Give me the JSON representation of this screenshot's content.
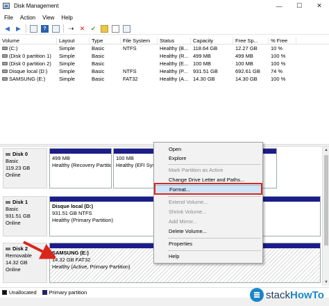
{
  "window": {
    "title": "Disk Management",
    "min": "—",
    "max": "☐",
    "close": "✕"
  },
  "menu": [
    "File",
    "Action",
    "View",
    "Help"
  ],
  "toolbar": {
    "icons": [
      "back-arrow-icon",
      "forward-arrow-icon",
      "disk-list-icon",
      "help-icon",
      "disk-grid-icon",
      "connect-icon",
      "delete-icon",
      "check-icon",
      "folder-icon",
      "document-icon",
      "properties-icon"
    ]
  },
  "columns": [
    "Volume",
    "Layout",
    "Type",
    "File System",
    "Status",
    "Capacity",
    "Free Sp...",
    "% Free"
  ],
  "volumes": [
    [
      "(C:)",
      "Simple",
      "Basic",
      "NTFS",
      "Healthy (B...",
      "118.64 GB",
      "12.27 GB",
      "10 %"
    ],
    [
      "(Disk 0 partition 1)",
      "Simple",
      "Basic",
      "",
      "Healthy (R...",
      "499 MB",
      "499 MB",
      "100 %"
    ],
    [
      "(Disk 0 partition 2)",
      "Simple",
      "Basic",
      "",
      "Healthy (E...",
      "100 MB",
      "100 MB",
      "100 %"
    ],
    [
      "Disque local (D:)",
      "Simple",
      "Basic",
      "NTFS",
      "Healthy (P...",
      "931.51 GB",
      "692.61 GB",
      "74 %"
    ],
    [
      "SAMSUNG (E:)",
      "Simple",
      "Basic",
      "FAT32",
      "Healthy (A...",
      "14.30 GB",
      "14.30 GB",
      "100 %"
    ]
  ],
  "disks": [
    {
      "name": "Disk 0",
      "type": "Basic",
      "size": "119.23 GB",
      "state": "Online",
      "partitions": [
        {
          "name": "",
          "size": "499 MB",
          "status": "Healthy (Recovery Partition)"
        },
        {
          "name": "",
          "size": "100 MB",
          "status": "Healthy (EFI System Partition)"
        },
        {
          "name": "",
          "size": "",
          "status": ""
        }
      ]
    },
    {
      "name": "Disk 1",
      "type": "Basic",
      "size": "931.51 GB",
      "state": "Online",
      "partitions": [
        {
          "name": "Disque local  (D:)",
          "size": "931.51 GB NTFS",
          "status": "Healthy (Primary Partition)"
        }
      ]
    },
    {
      "name": "Disk 2",
      "type": "Removable",
      "size": "14.32 GB",
      "state": "Online",
      "partitions": [
        {
          "name": "SAMSUNG  (E:)",
          "size": "14.32 GB FAT32",
          "status": "Healthy (Active, Primary Partition)"
        }
      ]
    }
  ],
  "context_menu": {
    "items": [
      {
        "label": "Open",
        "enabled": true
      },
      {
        "label": "Explore",
        "enabled": true
      },
      {
        "label": "Mark Partition as Active",
        "enabled": false
      },
      {
        "label": "Change Drive Letter and Paths...",
        "enabled": true
      },
      {
        "label": "Format...",
        "enabled": true,
        "highlighted": true
      },
      {
        "label": "Extend Volume...",
        "enabled": false
      },
      {
        "label": "Shrink Volume...",
        "enabled": false
      },
      {
        "label": "Add Mirror...",
        "enabled": false
      },
      {
        "label": "Delete Volume...",
        "enabled": true
      },
      {
        "label": "Properties",
        "enabled": true
      },
      {
        "label": "Help",
        "enabled": true
      }
    ]
  },
  "legend": {
    "unallocated": "Unallocated",
    "primary": "Primary partition"
  },
  "watermark": {
    "brand": "stack",
    "brand_bold": "HowTo"
  },
  "colors": {
    "partition_bar": "#1c1c8c",
    "highlight": "#cde4fa",
    "callout": "#d9261c"
  }
}
